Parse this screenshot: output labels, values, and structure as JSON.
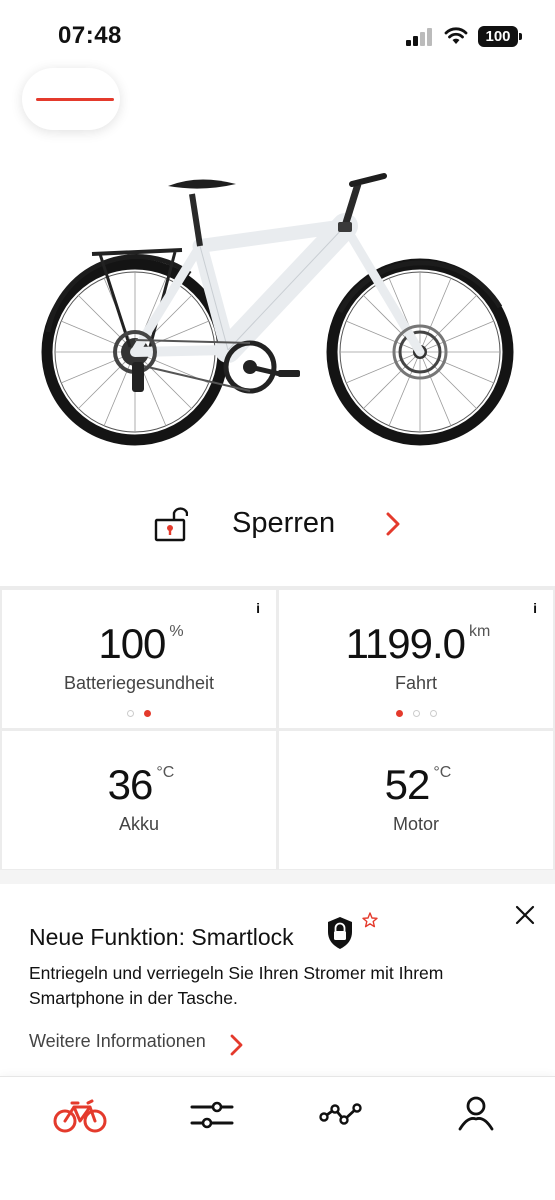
{
  "status_bar": {
    "time": "07:48",
    "battery": "100"
  },
  "lock": {
    "label": "Sperren",
    "icon": "padlock-open-icon"
  },
  "stats": [
    {
      "value": "100",
      "unit": "%",
      "label": "Batteriegesundheit",
      "info": "i",
      "dots_total": 2,
      "dot_active": 1
    },
    {
      "value": "1199.0",
      "unit": "km",
      "label": "Fahrt",
      "info": "i",
      "dots_total": 3,
      "dot_active": 0
    },
    {
      "value": "36",
      "unit": "°C",
      "label": "Akku"
    },
    {
      "value": "52",
      "unit": "°C",
      "label": "Motor"
    }
  ],
  "promo": {
    "title": "Neue Funktion: Smartlock",
    "text": "Entriegeln und verriegeln Sie Ihren Stromer mit Ihrem Smartphone in der Tasche.",
    "link": "Weitere Informationen"
  },
  "nav": [
    {
      "icon": "bike-icon",
      "active": true
    },
    {
      "icon": "sliders-icon",
      "active": false
    },
    {
      "icon": "route-icon",
      "active": false
    },
    {
      "icon": "profile-icon",
      "active": false
    }
  ],
  "colors": {
    "accent": "#e43a2c",
    "text": "#111111",
    "muted": "#444444",
    "divider": "#ececec",
    "bike_frame": "#e9ecef"
  }
}
